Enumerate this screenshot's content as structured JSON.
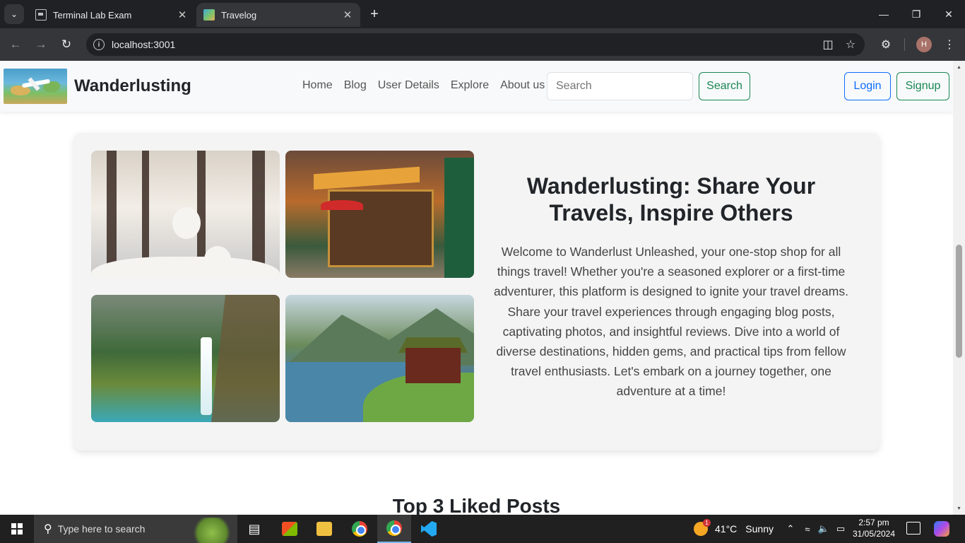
{
  "browser": {
    "tabs": [
      {
        "title": "Terminal Lab Exam",
        "active": false
      },
      {
        "title": "Travelog",
        "active": true
      }
    ],
    "url": "localhost:3001",
    "profile_initial": "H"
  },
  "site": {
    "brand": "Wanderlusting",
    "nav_links": [
      "Home",
      "Blog",
      "User Details",
      "Explore",
      "About us"
    ],
    "search_placeholder": "Search",
    "search_button": "Search",
    "login_button": "Login",
    "signup_button": "Signup",
    "colors": {
      "primary": "#0d6efd",
      "success": "#198754"
    }
  },
  "hero": {
    "title": "Wanderlusting: Share Your Travels, Inspire Others",
    "text": "Welcome to Wanderlust Unleashed, your one-stop shop for all things travel! Whether you're a seasoned explorer or a first-time adventurer, this platform is designed to ignite your travel dreams. Share your travel experiences through engaging blog posts, captivating photos, and insightful reviews. Dive into a world of diverse destinations, hidden gems, and practical tips from fellow travel enthusiasts. Let's embark on a journey together, one adventure at a time!",
    "photos": [
      "snowy-forest-snowmen-photo",
      "street-cafe-kiosk-photo",
      "mountain-waterfall-photo",
      "lakeside-cabin-photo"
    ]
  },
  "section": {
    "title": "Top 3 Liked Posts"
  },
  "taskbar": {
    "search_placeholder": "Type here to search",
    "weather_temp": "41°C",
    "weather_condition": "Sunny",
    "weather_badge": "1",
    "time": "2:57 pm",
    "date": "31/05/2024"
  }
}
